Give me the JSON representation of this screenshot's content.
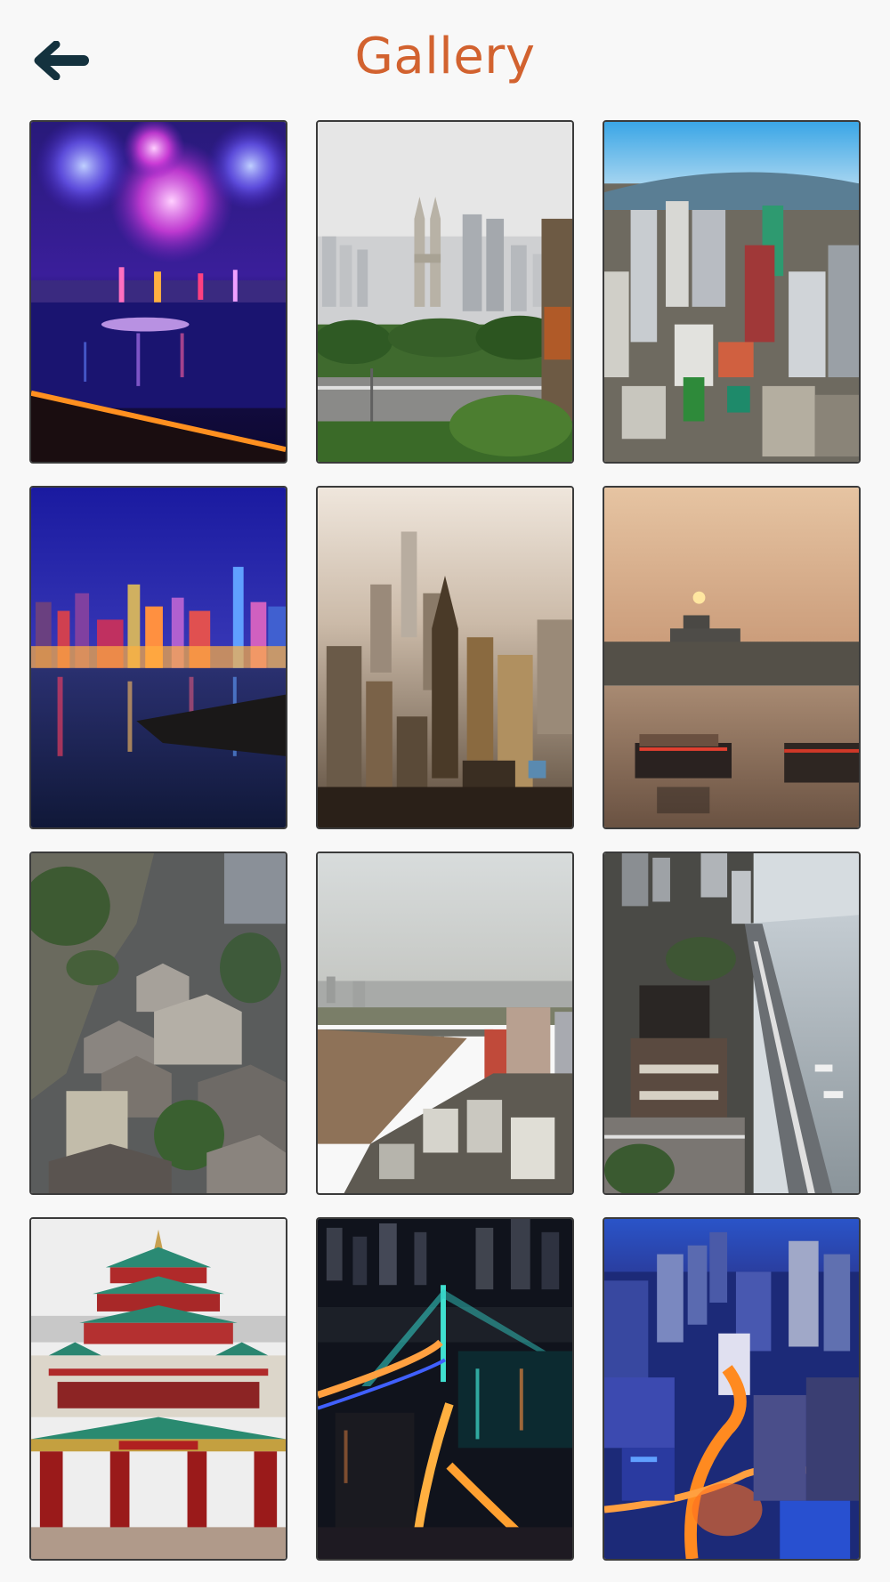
{
  "header": {
    "title": "Gallery",
    "back_icon": "arrow-left-icon",
    "title_color": "#d2622f"
  },
  "gallery": {
    "tiles": [
      {
        "icon": "fireworks-night-river-photo"
      },
      {
        "icon": "twin-towers-hazy-photo"
      },
      {
        "icon": "aerial-city-fisheye-photo"
      },
      {
        "icon": "night-skyline-river-photo"
      },
      {
        "icon": "aerial-skyscrapers-haze-photo"
      },
      {
        "icon": "sunset-river-boats-photo"
      },
      {
        "icon": "cliff-village-rooftops-photo"
      },
      {
        "icon": "river-bridge-cityscape-photo"
      },
      {
        "icon": "riverside-pavilion-road-photo"
      },
      {
        "icon": "great-hall-temple-photo"
      },
      {
        "icon": "night-bridge-lights-photo"
      },
      {
        "icon": "blue-hour-city-lights-photo"
      }
    ]
  }
}
